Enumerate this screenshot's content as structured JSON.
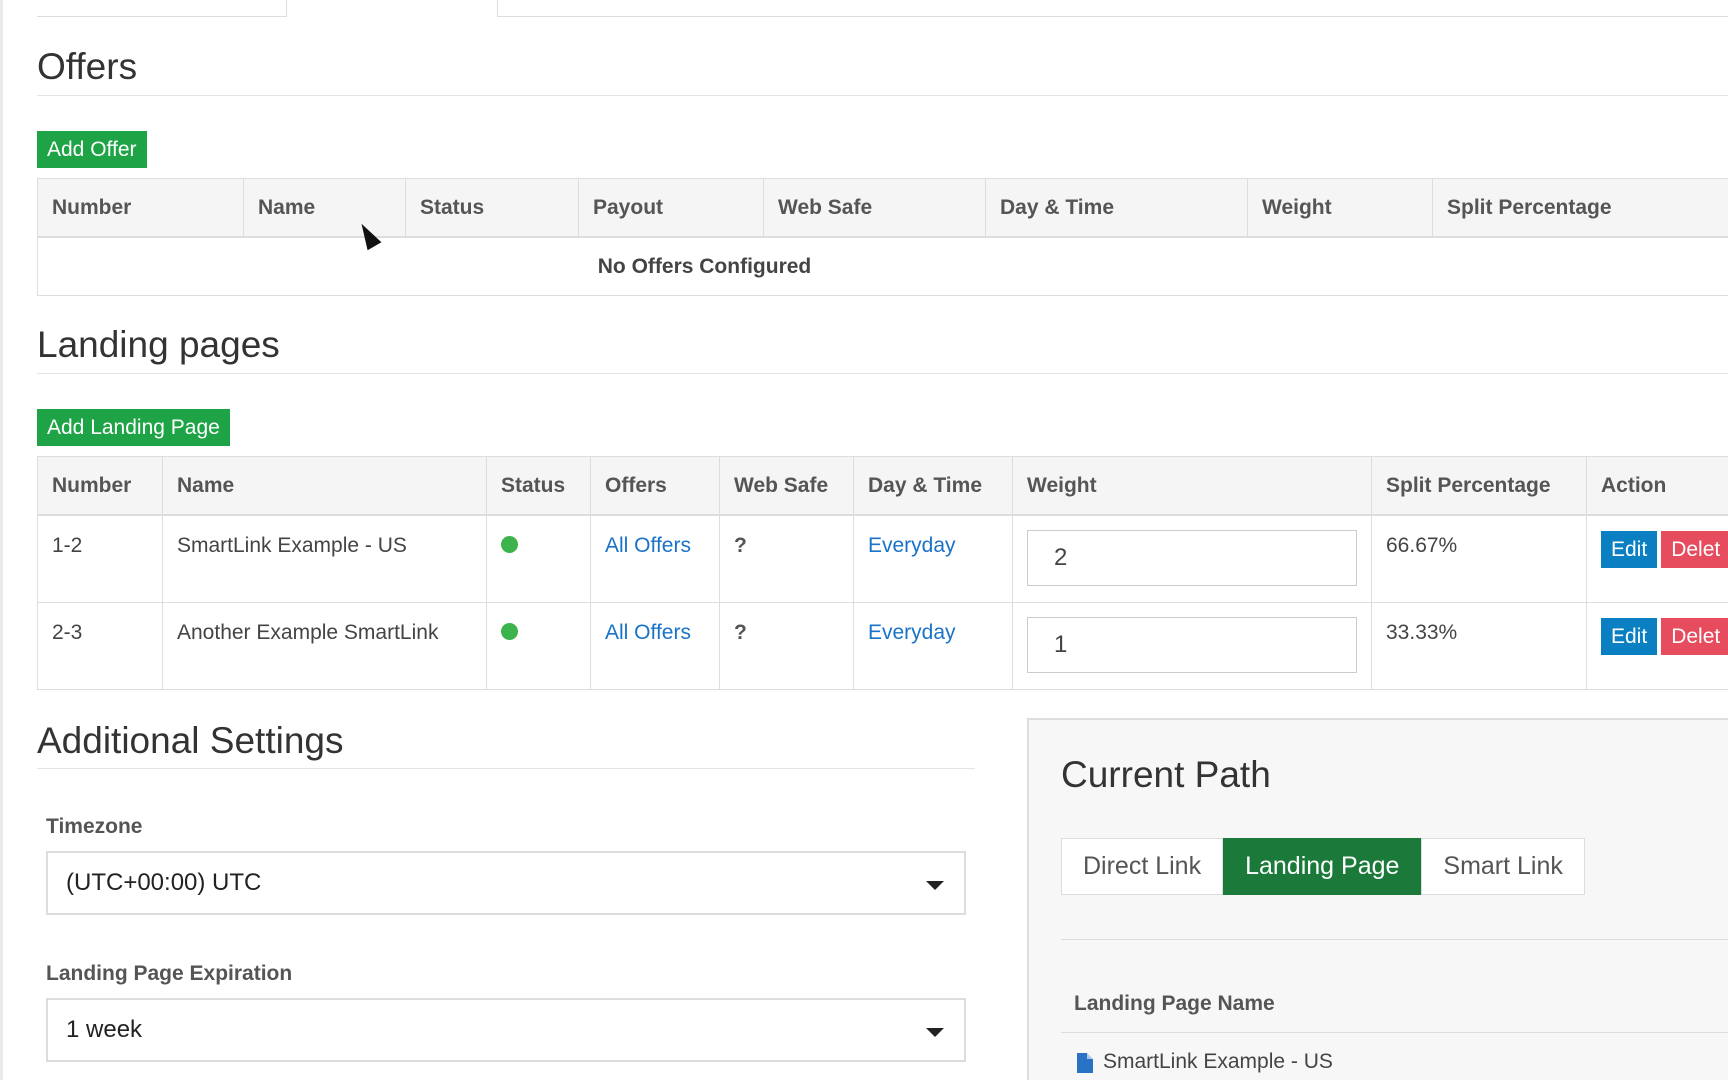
{
  "offers": {
    "title": "Offers",
    "add_button": "Add Offer",
    "columns": [
      "Number",
      "Name",
      "Status",
      "Payout",
      "Web Safe",
      "Day & Time",
      "Weight",
      "Split Percentage"
    ],
    "empty_message": "No Offers Configured"
  },
  "landing": {
    "title": "Landing pages",
    "add_button": "Add Landing Page",
    "columns": [
      "Number",
      "Name",
      "Status",
      "Offers",
      "Web Safe",
      "Day & Time",
      "Weight",
      "Split Percentage",
      "Action"
    ],
    "rows": [
      {
        "number": "1-2",
        "name": "SmartLink Example - US",
        "offers": "All Offers",
        "websafe": "?",
        "daytime": "Everyday",
        "weight": "2",
        "split": "66.67%",
        "edit": "Edit",
        "delete": "Delet"
      },
      {
        "number": "2-3",
        "name": "Another Example SmartLink",
        "offers": "All Offers",
        "websafe": "?",
        "daytime": "Everyday",
        "weight": "1",
        "split": "33.33%",
        "edit": "Edit",
        "delete": "Delet"
      }
    ],
    "status_color": "#3cb44b"
  },
  "settings": {
    "title": "Additional Settings",
    "timezone_label": "Timezone",
    "timezone_value": "(UTC+00:00) UTC",
    "expiration_label": "Landing Page Expiration",
    "expiration_value": "1 week"
  },
  "path": {
    "title": "Current Path",
    "tabs": [
      "Direct Link",
      "Landing Page",
      "Smart Link"
    ],
    "active_tab": "Landing Page",
    "lp_name_label": "Landing Page Name",
    "lp_name": "SmartLink Example - US"
  },
  "colors": {
    "accent_green": "#1ea446",
    "edit_blue": "#0a7fc2",
    "delete_red": "#e74c5e",
    "active_tab": "#1b7a3a"
  }
}
